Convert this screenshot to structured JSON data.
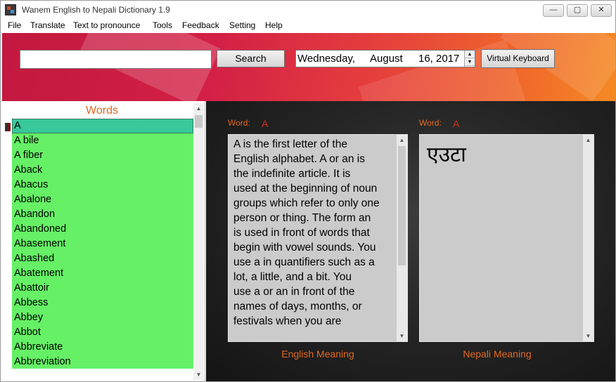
{
  "window": {
    "title": "Wanem  English to Nepali Dictionary 1.9",
    "controls": {
      "minimize": "—",
      "maximize": "▢",
      "close": "✕"
    }
  },
  "menu": [
    "File",
    "Translate",
    "Text to pronounce",
    "Tools",
    "Feedback",
    "Setting",
    "Help"
  ],
  "toolbar": {
    "search_value": "",
    "search_label": "Search",
    "date": {
      "weekday": "Wednesday,",
      "month": "August",
      "day_year": "16, 2017"
    },
    "virtual_keyboard_label": "Virtual Keyboard"
  },
  "word_list": {
    "title": "Words",
    "items": [
      "A",
      "A bile",
      "A fiber",
      "Aback",
      "Abacus",
      "Abalone",
      "Abandon",
      "Abandoned",
      "Abasement",
      "Abashed",
      "Abatement",
      "Abattoir",
      "Abbess",
      "Abbey",
      "Abbot",
      "Abbreviate",
      "Abbreviation"
    ],
    "selected": "A"
  },
  "english": {
    "word_label": "Word:",
    "word": "A",
    "meaning_lines": [
      "A is the first letter of the",
      "English alphabet. A or an is",
      "the indefinite article. It is",
      "used at the beginning of noun",
      "groups which refer to only one",
      "person or thing. The form an",
      "is used in front of words that",
      "begin with vowel sounds. You",
      "use a in quantifiers such as a",
      "lot, a little, and a bit.   You",
      "use a or an in front of the",
      "names of days, months, or",
      "festivals when you are"
    ],
    "caption": "English Meaning"
  },
  "nepali": {
    "word_label": "Word:",
    "word": "A",
    "meaning": "एउटा",
    "caption": "Nepali Meaning"
  },
  "colors": {
    "accent_orange": "#e2681f",
    "word_red": "#d83020",
    "list_green": "#66f066",
    "list_selected": "#38c89a",
    "header_gradient_start": "#c2183f",
    "header_gradient_end": "#f58a24"
  }
}
